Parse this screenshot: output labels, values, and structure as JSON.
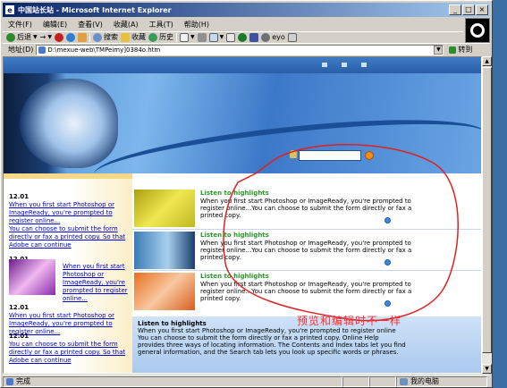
{
  "window": {
    "title": "中国站长站 - Microsoft Internet Explorer",
    "title_icon": "e",
    "min_icon": "minimize-icon",
    "max_icon": "maximize-icon",
    "close_icon": "close-icon"
  },
  "menu": [
    "文件(F)",
    "编辑(E)",
    "查看(V)",
    "收藏(A)",
    "工具(T)",
    "帮助(H)"
  ],
  "toolbar": {
    "back": "后退",
    "search": "搜索",
    "favorites": "收藏",
    "history": "历史",
    "eyo": "eyo"
  },
  "address": {
    "label": "地址(D)",
    "value": "D:\\mexue-web\\TMPeimy]0384o.htm",
    "go": "转到"
  },
  "page": {
    "sidebar": [
      {
        "date": "12.01",
        "text": "When you first start Photoshop or ImageReady, you're prompted to register online..."
      },
      {
        "date": "",
        "text": "You can choose to submit the form directly or fax a printed copy. So that Adobe can continue"
      },
      {
        "date": "12.01",
        "text": "When you first start Photoshop or ImageReady, you're prompted to register online..."
      },
      {
        "date": "12.01",
        "text": "When you first start Photoshop or ImageReady, you're prompted to register online..."
      },
      {
        "date": "12.01",
        "text": "You can choose to submit the form directly or fax a printed copy. So that Adobe can continue"
      }
    ],
    "highlights": [
      {
        "title": "Listen to highlights",
        "body": "When you first start Photoshop or ImageReady, you're prompted to register online...You can choose to submit the form directly or fax a printed copy."
      },
      {
        "title": "Listen to highlights",
        "body": "When you first start Photoshop or ImageReady, you're prompted to register online...You can choose to submit the form directly or fax a printed copy."
      },
      {
        "title": "Listen to highlights",
        "body": "When you first start Photoshop or ImageReady, you're prompted to register online...You can choose to submit the form directly or fax a printed copy."
      }
    ],
    "bottom_title": "Listen to highlights",
    "bottom_body": "When you first start Photoshop or ImageReady, you're prompted to register online You can choose to submit the form directly or fax a printed copy. Online Help provides three ways of locating information. The Contents and Index tabs let you find general information, and the Search tab lets you look up specific words or phrases.",
    "annotation": "预览和编辑时不一样"
  },
  "status": {
    "left": "完成",
    "zone": "我的电脑"
  },
  "colors": {
    "annotation": "#ff3030",
    "highlight_title": "#2a9a2a",
    "link": "#0000cc"
  }
}
